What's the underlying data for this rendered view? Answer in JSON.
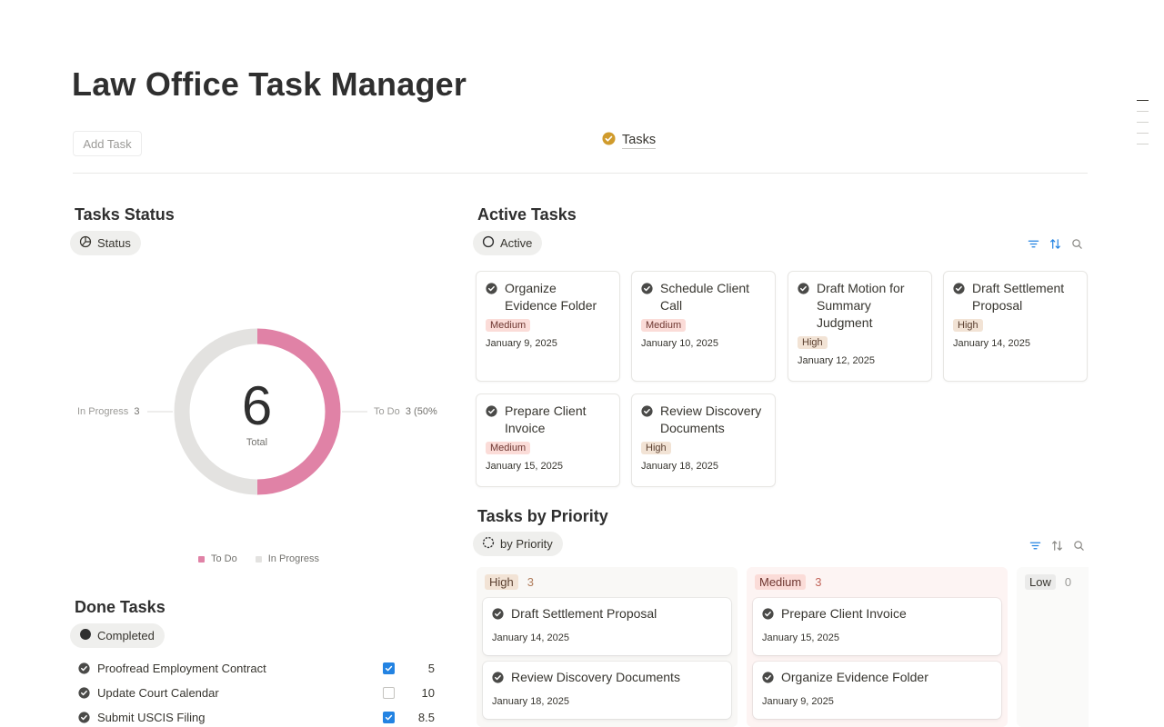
{
  "page": {
    "title": "Law Office Task Manager"
  },
  "header": {
    "add_task_label": "Add Task",
    "tasks_link_label": "Tasks"
  },
  "status_section": {
    "title": "Tasks Status",
    "view_label": "Status",
    "total": "6",
    "total_label": "Total",
    "left_label": "In Progress",
    "left_value": "3",
    "right_label": "To Do",
    "right_value": "3 (50%",
    "legend": [
      "To Do",
      "In Progress"
    ],
    "colors": {
      "todo": "#e082a6",
      "in_progress": "#e3e2e0"
    },
    "chart_data": {
      "type": "pie",
      "categories": [
        "To Do",
        "In Progress"
      ],
      "values": [
        3,
        3
      ],
      "title": "Total"
    }
  },
  "done_section": {
    "title": "Done Tasks",
    "view_label": "Completed",
    "rows": [
      {
        "name": "Proofread Employment Contract",
        "checked": true,
        "value": "5"
      },
      {
        "name": "Update Court Calendar",
        "checked": false,
        "value": "10"
      },
      {
        "name": "Submit USCIS Filing",
        "checked": true,
        "value": "8.5"
      }
    ]
  },
  "active_section": {
    "title": "Active Tasks",
    "view_label": "Active",
    "cards": [
      {
        "title": "Organize Evidence Folder",
        "priority": "Medium",
        "date": "January 9, 2025"
      },
      {
        "title": "Schedule Client Call",
        "priority": "Medium",
        "date": "January 10, 2025"
      },
      {
        "title": "Draft Motion for Summary Judgment",
        "priority": "High",
        "date": "January 12, 2025"
      },
      {
        "title": "Draft Settlement Proposal",
        "priority": "High",
        "date": "January 14, 2025"
      },
      {
        "title": "Prepare Client Invoice",
        "priority": "Medium",
        "date": "January 15, 2025"
      },
      {
        "title": "Review Discovery Documents",
        "priority": "High",
        "date": "January 18, 2025"
      }
    ]
  },
  "priority_section": {
    "title": "Tasks by Priority",
    "view_label": "by Priority",
    "columns": [
      {
        "name": "High",
        "count": "3",
        "cards": [
          {
            "title": "Draft Settlement Proposal",
            "date": "January 14, 2025"
          },
          {
            "title": "Review Discovery Documents",
            "date": "January 18, 2025"
          }
        ]
      },
      {
        "name": "Medium",
        "count": "3",
        "cards": [
          {
            "title": "Prepare Client Invoice",
            "date": "January 15, 2025"
          },
          {
            "title": "Organize Evidence Folder",
            "date": "January 9, 2025"
          }
        ]
      },
      {
        "name": "Low",
        "count": "0",
        "cards": []
      }
    ]
  }
}
